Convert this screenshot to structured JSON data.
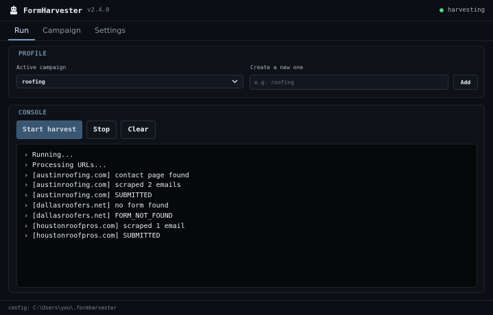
{
  "app": {
    "name": "FormHarvester",
    "version": "v2.4.0",
    "status": "harvesting",
    "status_color": "#5fd18a",
    "accent_color": "#6f9ccc",
    "logo_icon": "robot-icon"
  },
  "tabs": [
    {
      "label": "Run",
      "active": true
    },
    {
      "label": "Campaign",
      "active": false
    },
    {
      "label": "Settings",
      "active": false
    }
  ],
  "profile": {
    "title": "PROFILE",
    "active_campaign_label": "Active campaign",
    "active_campaign_value": "roofing",
    "new_label": "Create a new one",
    "new_placeholder": "e.g. roofing",
    "new_value": "",
    "add_label": "Add"
  },
  "console": {
    "title": "CONSOLE",
    "start_label": "Start harvest",
    "stop_label": "Stop",
    "clear_label": "Clear",
    "prompt": "›",
    "lines": [
      "Running...",
      "Processing URLs...",
      "[austinroofing.com] contact page found",
      "[austinroofing.com] scraped 2 emails",
      "[austinroofing.com] SUBMITTED",
      "[dallasroofers.net] no form found",
      "[dallasroofers.net] FORM_NOT_FOUND",
      "[houstonroofpros.com] scraped 1 email",
      "[houstonroofpros.com] SUBMITTED"
    ]
  },
  "footer": {
    "config": "config: C:\\Users\\you\\.formharvester"
  }
}
